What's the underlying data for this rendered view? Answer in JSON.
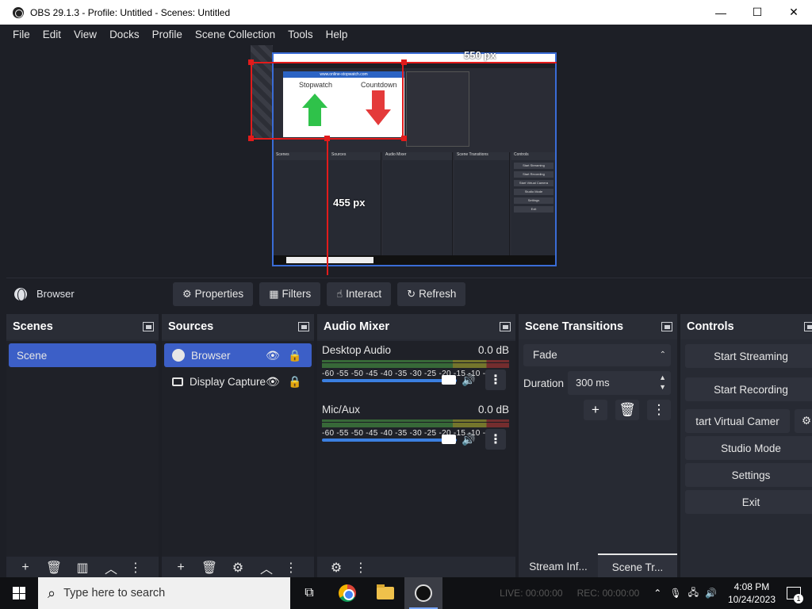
{
  "window": {
    "title": "OBS 29.1.3 - Profile: Untitled - Scenes: Untitled",
    "min": "—",
    "max": "☐",
    "close": "✕"
  },
  "menu": [
    "File",
    "Edit",
    "View",
    "Docks",
    "Profile",
    "Scene Collection",
    "Tools",
    "Help"
  ],
  "preview": {
    "width_label": "550 px",
    "height_label": "455 px",
    "nested": {
      "url": "www.online-stopwatch.com",
      "stopwatch": "Stopwatch",
      "countdown": "Countdown",
      "docks": [
        "Scenes",
        "Sources",
        "Audio Mixer",
        "Scene Transitions",
        "Controls"
      ],
      "controls": [
        "Start Streaming",
        "Start Recording",
        "Start Virtual Camera",
        "Studio Mode",
        "Settings",
        "Exit"
      ],
      "search": "Type here to search"
    }
  },
  "context": {
    "source_name": "Browser",
    "buttons": {
      "properties": "Properties",
      "filters": "Filters",
      "interact": "Interact",
      "refresh": "Refresh"
    }
  },
  "scenes": {
    "title": "Scenes",
    "items": [
      "Scene"
    ]
  },
  "sources": {
    "title": "Sources",
    "items": [
      "Browser",
      "Display Capture"
    ]
  },
  "mixer": {
    "title": "Audio Mixer",
    "ticks": "-60 -55 -50 -45 -40 -35 -30 -25 -20 -15 -10  -5   0",
    "channels": [
      {
        "name": "Desktop Audio",
        "db": "0.0 dB",
        "volume": 0.9
      },
      {
        "name": "Mic/Aux",
        "db": "0.0 dB",
        "volume": 0.9
      }
    ]
  },
  "transitions": {
    "title": "Scene Transitions",
    "selected": "Fade",
    "duration_label": "Duration",
    "duration_value": "300 ms",
    "tabs": [
      "Stream Inf...",
      "Scene Tr..."
    ]
  },
  "controls": {
    "title": "Controls",
    "start_streaming": "Start Streaming",
    "start_recording": "Start Recording",
    "virtual_camera": "tart Virtual Camer",
    "studio_mode": "Studio Mode",
    "settings": "Settings",
    "exit": "Exit"
  },
  "taskbar": {
    "search_placeholder": "Type here to search",
    "live": "LIVE: 00:00:00",
    "rec": "REC: 00:00:00",
    "time": "4:08 PM",
    "date": "10/24/2023",
    "notifications": "1"
  }
}
